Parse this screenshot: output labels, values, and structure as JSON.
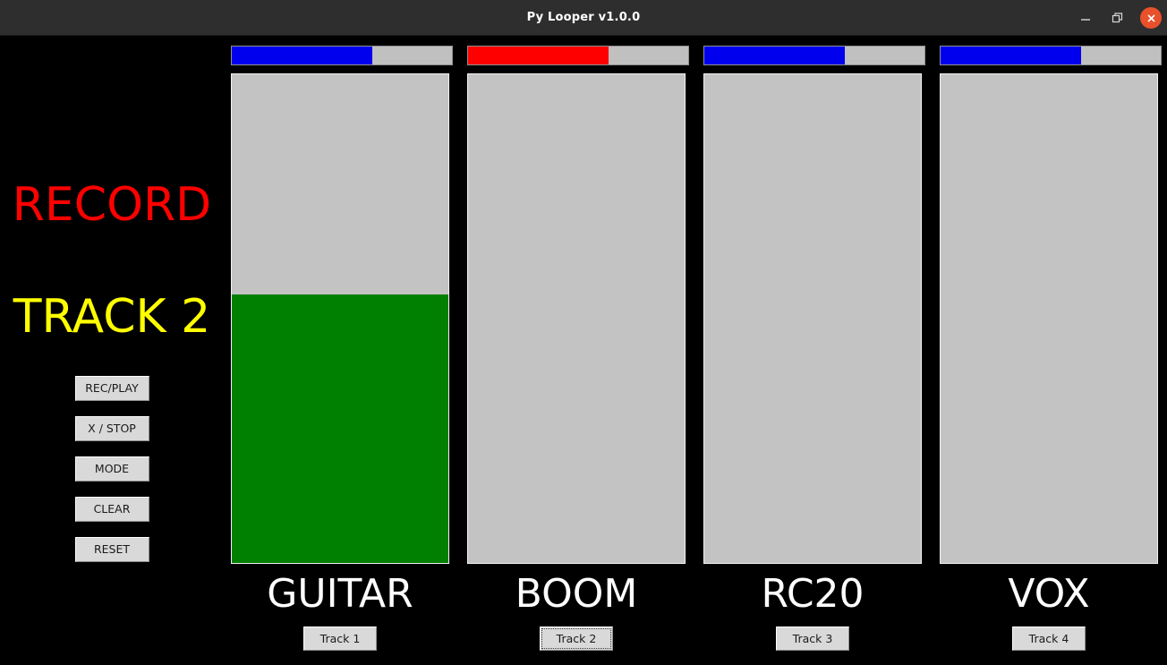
{
  "window": {
    "title": "Py Looper v1.0.0",
    "titlebar_bg": "#2e2e2e",
    "controls": {
      "minimize": "minimize",
      "maximize": "maximize",
      "close": "close",
      "close_bg": "#e8512b"
    }
  },
  "left_panel": {
    "mode_status": "RECORD",
    "mode_status_color": "#ff0000",
    "track_status": "TRACK 2",
    "track_status_color": "#ffff00",
    "buttons": [
      {
        "label": "REC/PLAY"
      },
      {
        "label": "X / STOP"
      },
      {
        "label": "MODE"
      },
      {
        "label": "CLEAR"
      },
      {
        "label": "RESET"
      }
    ]
  },
  "colors": {
    "background": "#000000",
    "progress_idle": "#0000ee",
    "progress_recording": "#ff0000",
    "progress_track_bg": "#c0c0c0",
    "meter_bg": "#c3c3c3",
    "meter_fill": "#008000",
    "button_face": "#d9d9d9"
  },
  "tracks": [
    {
      "name": "GUITAR",
      "button_label": "Track 1",
      "button_focused": false,
      "progress_percent": 64,
      "progress_color": "#0000ee",
      "meter_percent": 55
    },
    {
      "name": "BOOM",
      "button_label": "Track 2",
      "button_focused": true,
      "progress_percent": 64,
      "progress_color": "#ff0000",
      "meter_percent": 0
    },
    {
      "name": "RC20",
      "button_label": "Track 3",
      "button_focused": false,
      "progress_percent": 64,
      "progress_color": "#0000ee",
      "meter_percent": 0
    },
    {
      "name": "VOX",
      "button_label": "Track 4",
      "button_focused": false,
      "progress_percent": 64,
      "progress_color": "#0000ee",
      "meter_percent": 0
    }
  ]
}
